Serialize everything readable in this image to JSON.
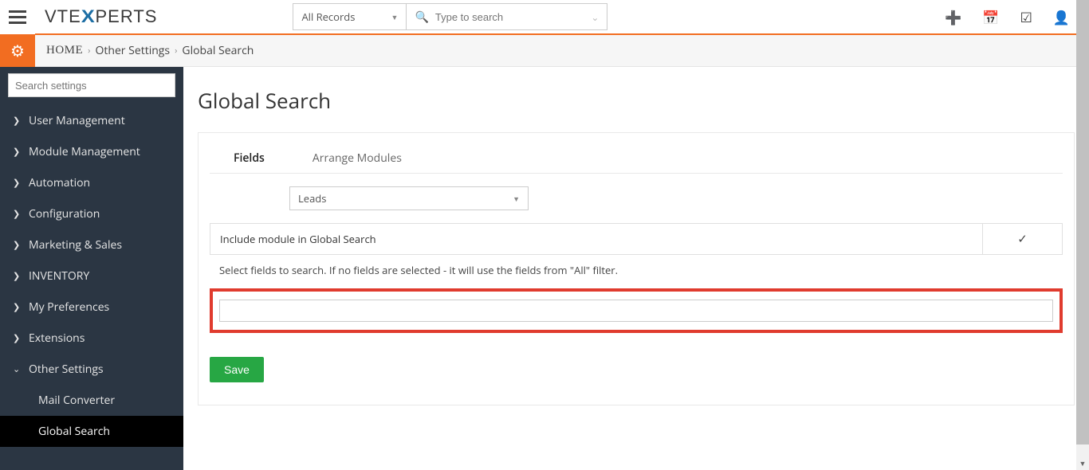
{
  "header": {
    "logo_pre": "VTE",
    "logo_x": "X",
    "logo_post": "PERTS",
    "records_selector": "All Records",
    "search_placeholder": "Type to search"
  },
  "breadcrumb": {
    "home": "HOME",
    "other_settings": "Other Settings",
    "global_search": "Global Search"
  },
  "sidebar": {
    "search_placeholder": "Search settings",
    "items": [
      {
        "label": "User Management",
        "expanded": false
      },
      {
        "label": "Module Management",
        "expanded": false
      },
      {
        "label": "Automation",
        "expanded": false
      },
      {
        "label": "Configuration",
        "expanded": false
      },
      {
        "label": "Marketing & Sales",
        "expanded": false
      },
      {
        "label": "INVENTORY",
        "expanded": false
      },
      {
        "label": "My Preferences",
        "expanded": false
      },
      {
        "label": "Extensions",
        "expanded": false
      }
    ],
    "other_settings": {
      "label": "Other Settings",
      "children": [
        {
          "label": "Mail Converter",
          "active": false
        },
        {
          "label": "Global Search",
          "active": true
        }
      ]
    }
  },
  "main": {
    "title": "Global Search",
    "tabs": {
      "fields": "Fields",
      "arrange": "Arrange Modules"
    },
    "module_selected": "Leads",
    "include_label": "Include module in Global Search",
    "include_checked": true,
    "helper": "Select fields to search. If no fields are selected - it will use the fields from \"All\" filter.",
    "fields_value": "",
    "save_label": "Save"
  }
}
